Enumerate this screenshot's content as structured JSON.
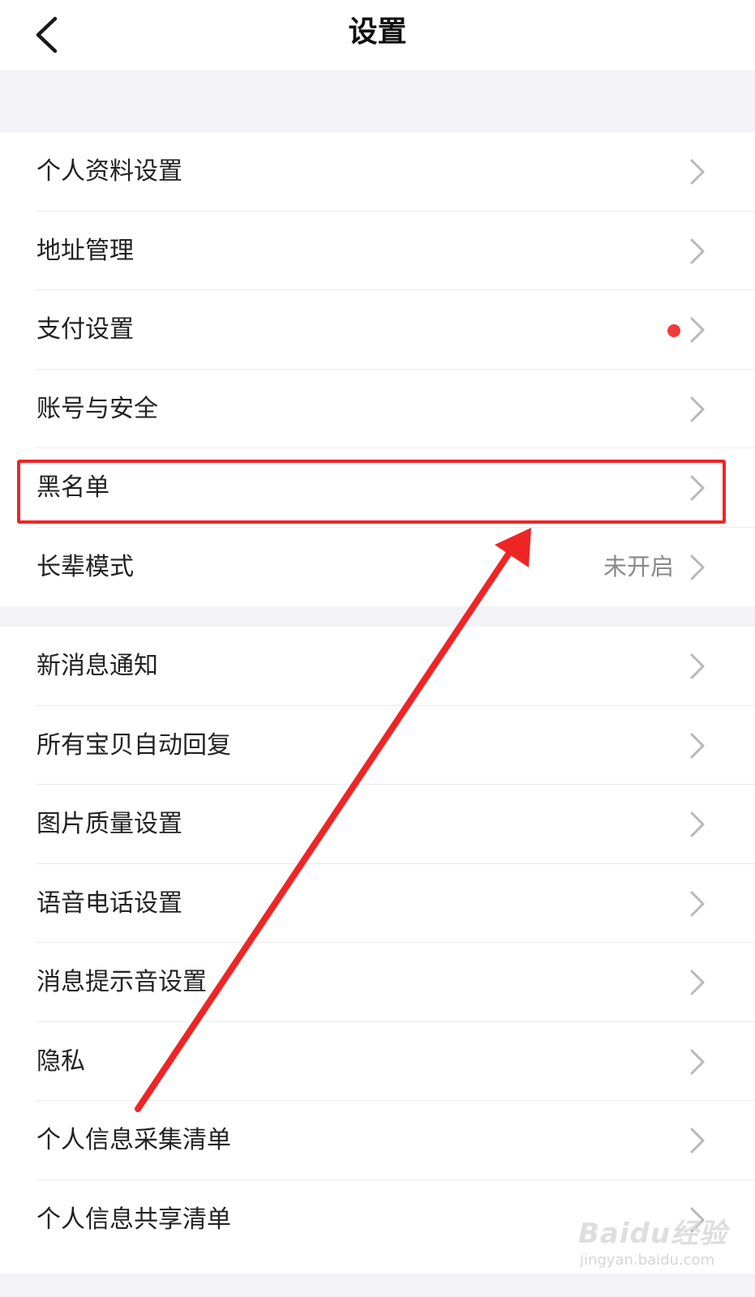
{
  "header": {
    "title": "设置",
    "back_icon": "chevron-left-icon"
  },
  "section1": {
    "items": [
      {
        "label": "个人资料设置"
      },
      {
        "label": "地址管理"
      },
      {
        "label": "支付设置",
        "badge": "red-dot"
      },
      {
        "label": "账号与安全"
      },
      {
        "label": "黑名单",
        "highlighted": true
      },
      {
        "label": "长辈模式",
        "value": "未开启"
      }
    ]
  },
  "section2": {
    "items": [
      {
        "label": "新消息通知"
      },
      {
        "label": "所有宝贝自动回复"
      },
      {
        "label": "图片质量设置"
      },
      {
        "label": "语音电话设置"
      },
      {
        "label": "消息提示音设置"
      },
      {
        "label": "隐私"
      },
      {
        "label": "个人信息采集清单"
      },
      {
        "label": "个人信息共享清单"
      }
    ]
  },
  "annotation": {
    "color": "#ef2525",
    "type": "red-box-and-arrow"
  },
  "watermark": {
    "text": "Baidu经验",
    "sub": "jingyan.baidu.com"
  },
  "colors": {
    "background": "#f3f2f7",
    "badge": "#f23b3b",
    "value_text": "#8a8a8a"
  }
}
